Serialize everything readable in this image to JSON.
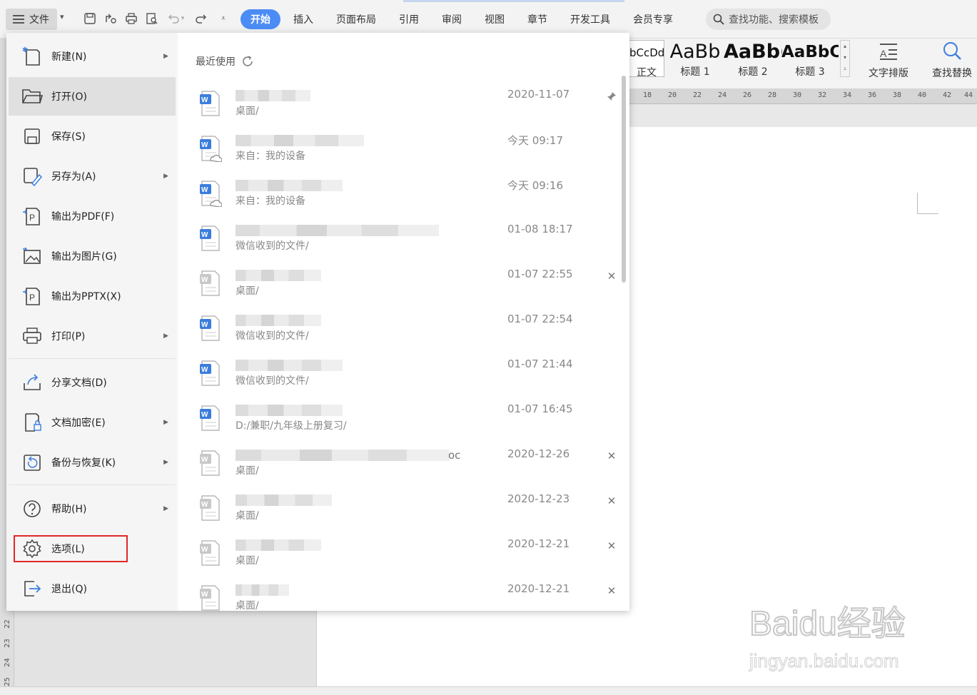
{
  "toolbar": {
    "file_label": "文件",
    "tabs": [
      "开始",
      "插入",
      "页面布局",
      "引用",
      "审阅",
      "视图",
      "章节",
      "开发工具",
      "会员专享"
    ],
    "search_placeholder": "查找功能、搜索模板"
  },
  "ribbon": {
    "styles": [
      {
        "sample": "bCcDd",
        "label": "正文"
      },
      {
        "sample": "AaBb",
        "label": "标题 1"
      },
      {
        "sample": "AaBb(",
        "label": "标题 2"
      },
      {
        "sample": "AaBbC",
        "label": "标题 3"
      }
    ],
    "text_layout_label": "文字排版",
    "find_replace_label": "查找替换"
  },
  "ruler": {
    "h_ticks": [
      "18",
      "20",
      "22",
      "24",
      "26",
      "28",
      "30",
      "32",
      "34",
      "36",
      "38",
      "40",
      "42",
      "44"
    ],
    "v_ticks": [
      "22",
      "23",
      "24",
      "25"
    ]
  },
  "file_menu": {
    "items": [
      {
        "label": "新建(N)",
        "has_arrow": true
      },
      {
        "label": "打开(O)",
        "has_arrow": false
      },
      {
        "label": "保存(S)",
        "has_arrow": false
      },
      {
        "label": "另存为(A)",
        "has_arrow": true
      },
      {
        "label": "输出为PDF(F)",
        "has_arrow": false
      },
      {
        "label": "输出为图片(G)",
        "has_arrow": false
      },
      {
        "label": "输出为PPTX(X)",
        "has_arrow": false
      },
      {
        "label": "打印(P)",
        "has_arrow": true
      },
      {
        "label": "分享文档(D)",
        "has_arrow": false
      },
      {
        "label": "文档加密(E)",
        "has_arrow": true
      },
      {
        "label": "备份与恢复(K)",
        "has_arrow": true
      },
      {
        "label": "帮助(H)",
        "has_arrow": true
      },
      {
        "label": "选项(L)",
        "has_arrow": false
      },
      {
        "label": "退出(Q)",
        "has_arrow": false
      }
    ]
  },
  "recent": {
    "title": "最近使用",
    "items": [
      {
        "sub": "桌面/",
        "date": "2020-11-07",
        "action": "pin"
      },
      {
        "sub": "来自：我的设备",
        "date": "今天 09:17",
        "action": ""
      },
      {
        "sub": "来自：我的设备",
        "date": "今天 09:16",
        "action": ""
      },
      {
        "sub": "微信收到的文件/",
        "date": "01-08 18:17",
        "action": ""
      },
      {
        "sub": "桌面/",
        "date": "01-07 22:55",
        "action": "remove"
      },
      {
        "sub": "微信收到的文件/",
        "date": "01-07 22:54",
        "action": ""
      },
      {
        "sub": "微信收到的文件/",
        "date": "01-07 21:44",
        "action": ""
      },
      {
        "sub": "D:/兼职/九年级上册复习/",
        "date": "01-07 16:45",
        "action": ""
      },
      {
        "sub": "桌面/",
        "date": "2020-12-26",
        "action": "remove",
        "suffix": "oc"
      },
      {
        "sub": "桌面/",
        "date": "2020-12-23",
        "action": "remove"
      },
      {
        "sub": "桌面/",
        "date": "2020-12-21",
        "action": "remove"
      },
      {
        "sub": "桌面/",
        "date": "2020-12-21",
        "action": "remove"
      }
    ]
  },
  "watermark": {
    "line1": "Baidu经验",
    "line2": "jingyan.baidu.com"
  },
  "colors": {
    "accent": "#4b8cf5",
    "highlight": "#e02828"
  }
}
